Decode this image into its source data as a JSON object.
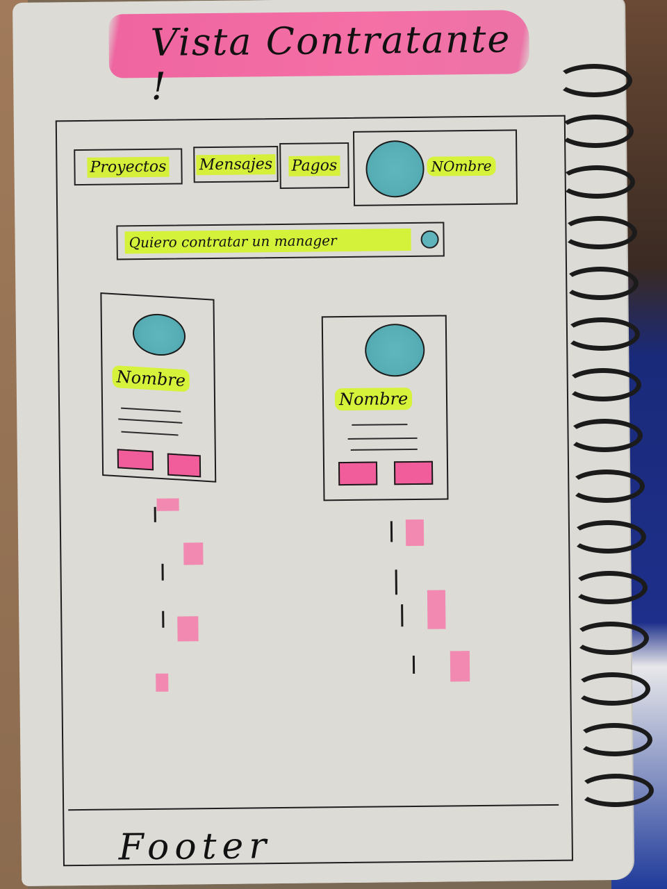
{
  "title": "Vista Contratante !",
  "nav": {
    "tabs": [
      {
        "label": "Proyectos"
      },
      {
        "label": "Mensajes"
      },
      {
        "label": "Pagos"
      }
    ],
    "profile_name": "NOmbre"
  },
  "search": {
    "placeholder": "Quiero contratar un manager"
  },
  "cards": [
    {
      "name": "Nombre"
    },
    {
      "name": "Nombre"
    }
  ],
  "footer": {
    "label": "Footer"
  },
  "colors": {
    "pink_highlight": "#f25b97",
    "lime_highlight": "#d8f23a",
    "avatar_teal": "#5fb4bc",
    "paper": "#dcdbd6"
  }
}
